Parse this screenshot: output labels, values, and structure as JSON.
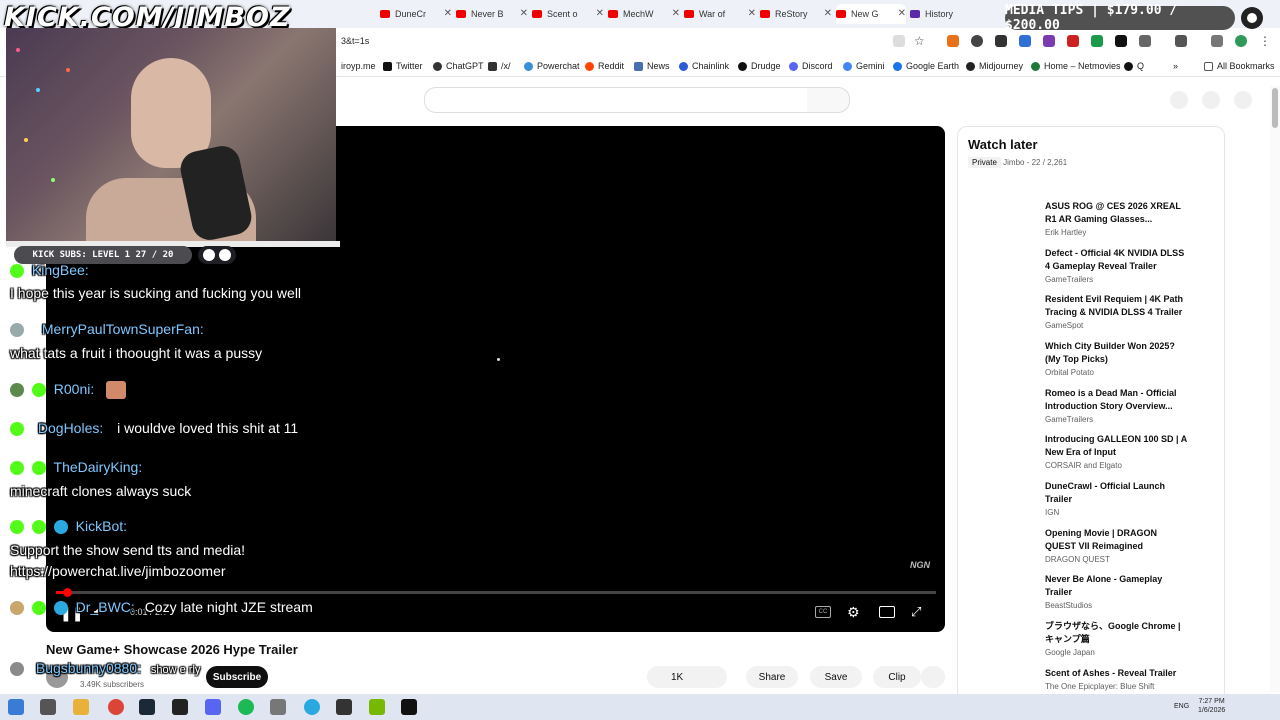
{
  "browser": {
    "tabs": [
      {
        "label": "DuneCr"
      },
      {
        "label": "Never B"
      },
      {
        "label": "Scent o"
      },
      {
        "label": "MechW"
      },
      {
        "label": "War of"
      },
      {
        "label": "ReStory"
      },
      {
        "label": "New G",
        "active": true
      },
      {
        "label": "History"
      }
    ],
    "url": "3&t=1s",
    "bookmarks": [
      "iroyp.me",
      "Twitter",
      "ChatGPT",
      "/x/",
      "Powerchat",
      "Reddit",
      "News",
      "Chainlink",
      "Drudge",
      "Discord",
      "Gemini",
      "Google Earth",
      "Midjourney",
      "Home – Netmovies",
      "Q"
    ],
    "all_bookmarks": "All Bookmarks",
    "more_bookmarks": "»"
  },
  "player": {
    "time": "0:01 / 2:?",
    "watermark": "NGN",
    "progress_fraction": 0.01
  },
  "video": {
    "title": "New Game+ Showcase 2026 Hype Trailer",
    "subscribers": "3.49K subscribers",
    "subscribe": "Subscribe",
    "likes": "1K",
    "share": "Share",
    "save": "Save",
    "clip": "Clip"
  },
  "playlist": {
    "title": "Watch later",
    "privacy": "Private",
    "meta": "Jimbo - 22 / 2,261",
    "items": [
      {
        "title": "ASUS ROG @ CES 2026 XREAL R1 AR Gaming Glasses...",
        "channel": "Erik Hartley"
      },
      {
        "title": "Defect - Official 4K NVIDIA DLSS 4 Gameplay Reveal Trailer",
        "channel": "GameTrailers"
      },
      {
        "title": "Resident Evil Requiem | 4K Path Tracing & NVIDIA DLSS 4 Trailer",
        "channel": "GameSpot"
      },
      {
        "title": "Which City Builder Won 2025? (My Top Picks)",
        "channel": "Orbital Potato"
      },
      {
        "title": "Romeo is a Dead Man - Official Introduction Story Overview...",
        "channel": "GameTrailers"
      },
      {
        "title": "Introducing GALLEON 100 SD | A New Era of Input",
        "channel": "CORSAIR and Elgato"
      },
      {
        "title": "DuneCrawl - Official Launch Trailer",
        "channel": "IGN"
      },
      {
        "title": "Opening Movie | DRAGON QUEST VII Reimagined",
        "channel": "DRAGON QUEST"
      },
      {
        "title": "Never Be Alone - Gameplay Trailer",
        "channel": "BeastStudios"
      },
      {
        "title": "ブラウザなら、Google Chrome | キャンプ篇",
        "channel": "Google Japan"
      },
      {
        "title": "Scent of Ashes - Reveal Trailer",
        "channel": "The One Epicplayer: Blue Shift"
      }
    ]
  },
  "overlay": {
    "logo": "KICK.COM/JIMBOZ",
    "sub_goal": "KICK SUBS: LEVEL 1 27 / 20",
    "media_tips": "MEDIA TIPS | $179.00 / $200.00",
    "chat": [
      {
        "name": "KingBee:",
        "message": "I hope this year is sucking and fucking you well",
        "name_color": "#53fc18"
      },
      {
        "name": "MerryPaulTownSuperFan:",
        "message": "what tats a fruit i thoought it was a pussy",
        "name_color": "#7ec8ff"
      },
      {
        "name": "R00ni:",
        "message": "",
        "name_color": "#7ec8ff"
      },
      {
        "name": "DogHoles:",
        "message": "i wouldve loved this shit at 11",
        "name_color": "#7ec8ff"
      },
      {
        "name": "TheDairyKing:",
        "message": "minecraft clones always suck",
        "name_color": "#7ec8ff"
      },
      {
        "name": "KickBot:",
        "message": "Support the show send tts and media!",
        "message2": "https://powerchat.live/jimbozoomer",
        "name_color": "#7ec8ff"
      },
      {
        "name": "Dr_BWC:",
        "message": "Cozy late night JZE stream",
        "name_color": "#7ec8ff"
      },
      {
        "name": "Bugsbunny0880:",
        "message": "show e rly",
        "name_color": "#7ec8ff"
      }
    ]
  },
  "taskbar": {
    "lang": "ENG",
    "time": "7:27 PM",
    "date": "1/6/2026"
  }
}
